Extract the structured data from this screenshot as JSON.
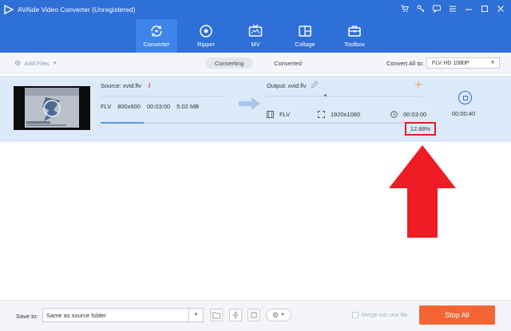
{
  "app": {
    "title": "AVAide Video Converter (Unregistered)",
    "colors": {
      "brand": "#2e6fd8",
      "accent": "#f46533",
      "annotation": "#e02020"
    }
  },
  "nav": [
    {
      "label": "Converter",
      "icon": "converter-icon",
      "active": true
    },
    {
      "label": "Ripper",
      "icon": "disc-icon"
    },
    {
      "label": "MV",
      "icon": "tv-icon"
    },
    {
      "label": "Collage",
      "icon": "collage-icon"
    },
    {
      "label": "Toolbox",
      "icon": "toolbox-icon"
    }
  ],
  "toolbar": {
    "add_files": "Add Files",
    "tabs": [
      "Converting",
      "Converted"
    ],
    "convert_all_label": "Convert All to:",
    "convert_all_value": "FLV HD 1080P"
  },
  "file": {
    "source_label": "Source: xvid.flv",
    "src_format": "FLV",
    "src_resolution": "800x600",
    "src_duration": "00:03:00",
    "src_size": "5.02 MB",
    "output_label": "Output: xvid.flv",
    "out_format": "FLV",
    "out_resolution": "1920x1080",
    "out_duration": "00:03:00",
    "progress_text": "12.88%",
    "progress": 0.1288,
    "elapsed": "00:00:40"
  },
  "bottom": {
    "save_to_label": "Save to:",
    "save_to_value": "Same as source folder",
    "merge_label": "Merge into one file",
    "stop_all": "Stop All"
  }
}
